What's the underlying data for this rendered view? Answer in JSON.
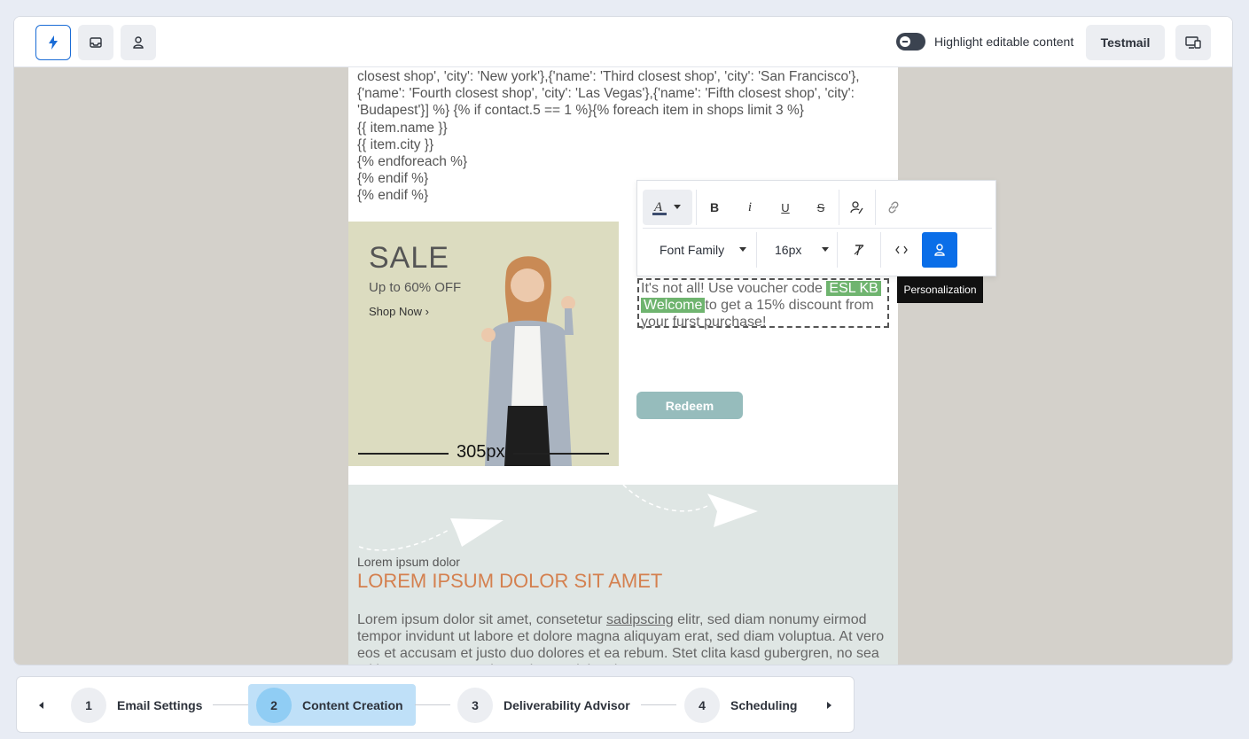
{
  "topbar": {
    "highlight_label": "Highlight editable content",
    "testmail_label": "Testmail"
  },
  "email": {
    "code_lines": [
      "closest shop', 'city': 'New york'},{'name': 'Third closest shop', 'city': 'San Francisco'},",
      "{'name': 'Fourth closest shop', 'city': 'Las Vegas'},{'name': 'Fifth closest shop', 'city':",
      "'Budapest'}] %} {% if contact.5 == 1 %}{% foreach item in shops limit 3 %}",
      "{{ item.name }}",
      "{{ item.city }}",
      "{% endforeach %}",
      "{% endif %}",
      "{% endif %}"
    ],
    "sale": {
      "title": "SALE",
      "subtitle": "Up to 60% OFF",
      "shop_now": "Shop Now"
    },
    "width_indicator": "305px",
    "promo": {
      "before": "It's not all! Use  voucher code ",
      "code1": "ESL KB",
      "code2": "Welcome",
      "after": "to get a 15% discount from your furst purchase!"
    },
    "redeem_label": "Redeem",
    "lorem_small": "Lorem ipsum dolor",
    "lorem_title": "LOREM IPSUM DOLOR SIT AMET",
    "lorem_body_start": "Lorem ipsum dolor sit amet, consetetur ",
    "lorem_body_link": "sadipscing",
    "lorem_body_rest": " elitr, sed diam nonumy eirmod tempor invidunt ut labore et dolore magna aliquyam erat, sed diam voluptua. At vero eos et accusam et justo duo dolores et ea rebum. Stet clita kasd gubergren, no sea takimata sanctus est lorem ipsum dolor sit amet."
  },
  "toolbar": {
    "bold": "B",
    "italic": "i",
    "underline": "U",
    "strike": "S",
    "font_family": "Font Family",
    "font_size": "16px",
    "tooltip": "Personalization"
  },
  "stepper": {
    "steps": [
      {
        "num": "1",
        "label": "Email Settings"
      },
      {
        "num": "2",
        "label": "Content Creation"
      },
      {
        "num": "3",
        "label": "Deliverability Advisor"
      },
      {
        "num": "4",
        "label": "Scheduling"
      }
    ]
  },
  "colors": {
    "accent": "#0a6ee8",
    "chip": "#6fb46f",
    "lorem_title": "#d4804f",
    "redeem": "#96bcbc"
  }
}
